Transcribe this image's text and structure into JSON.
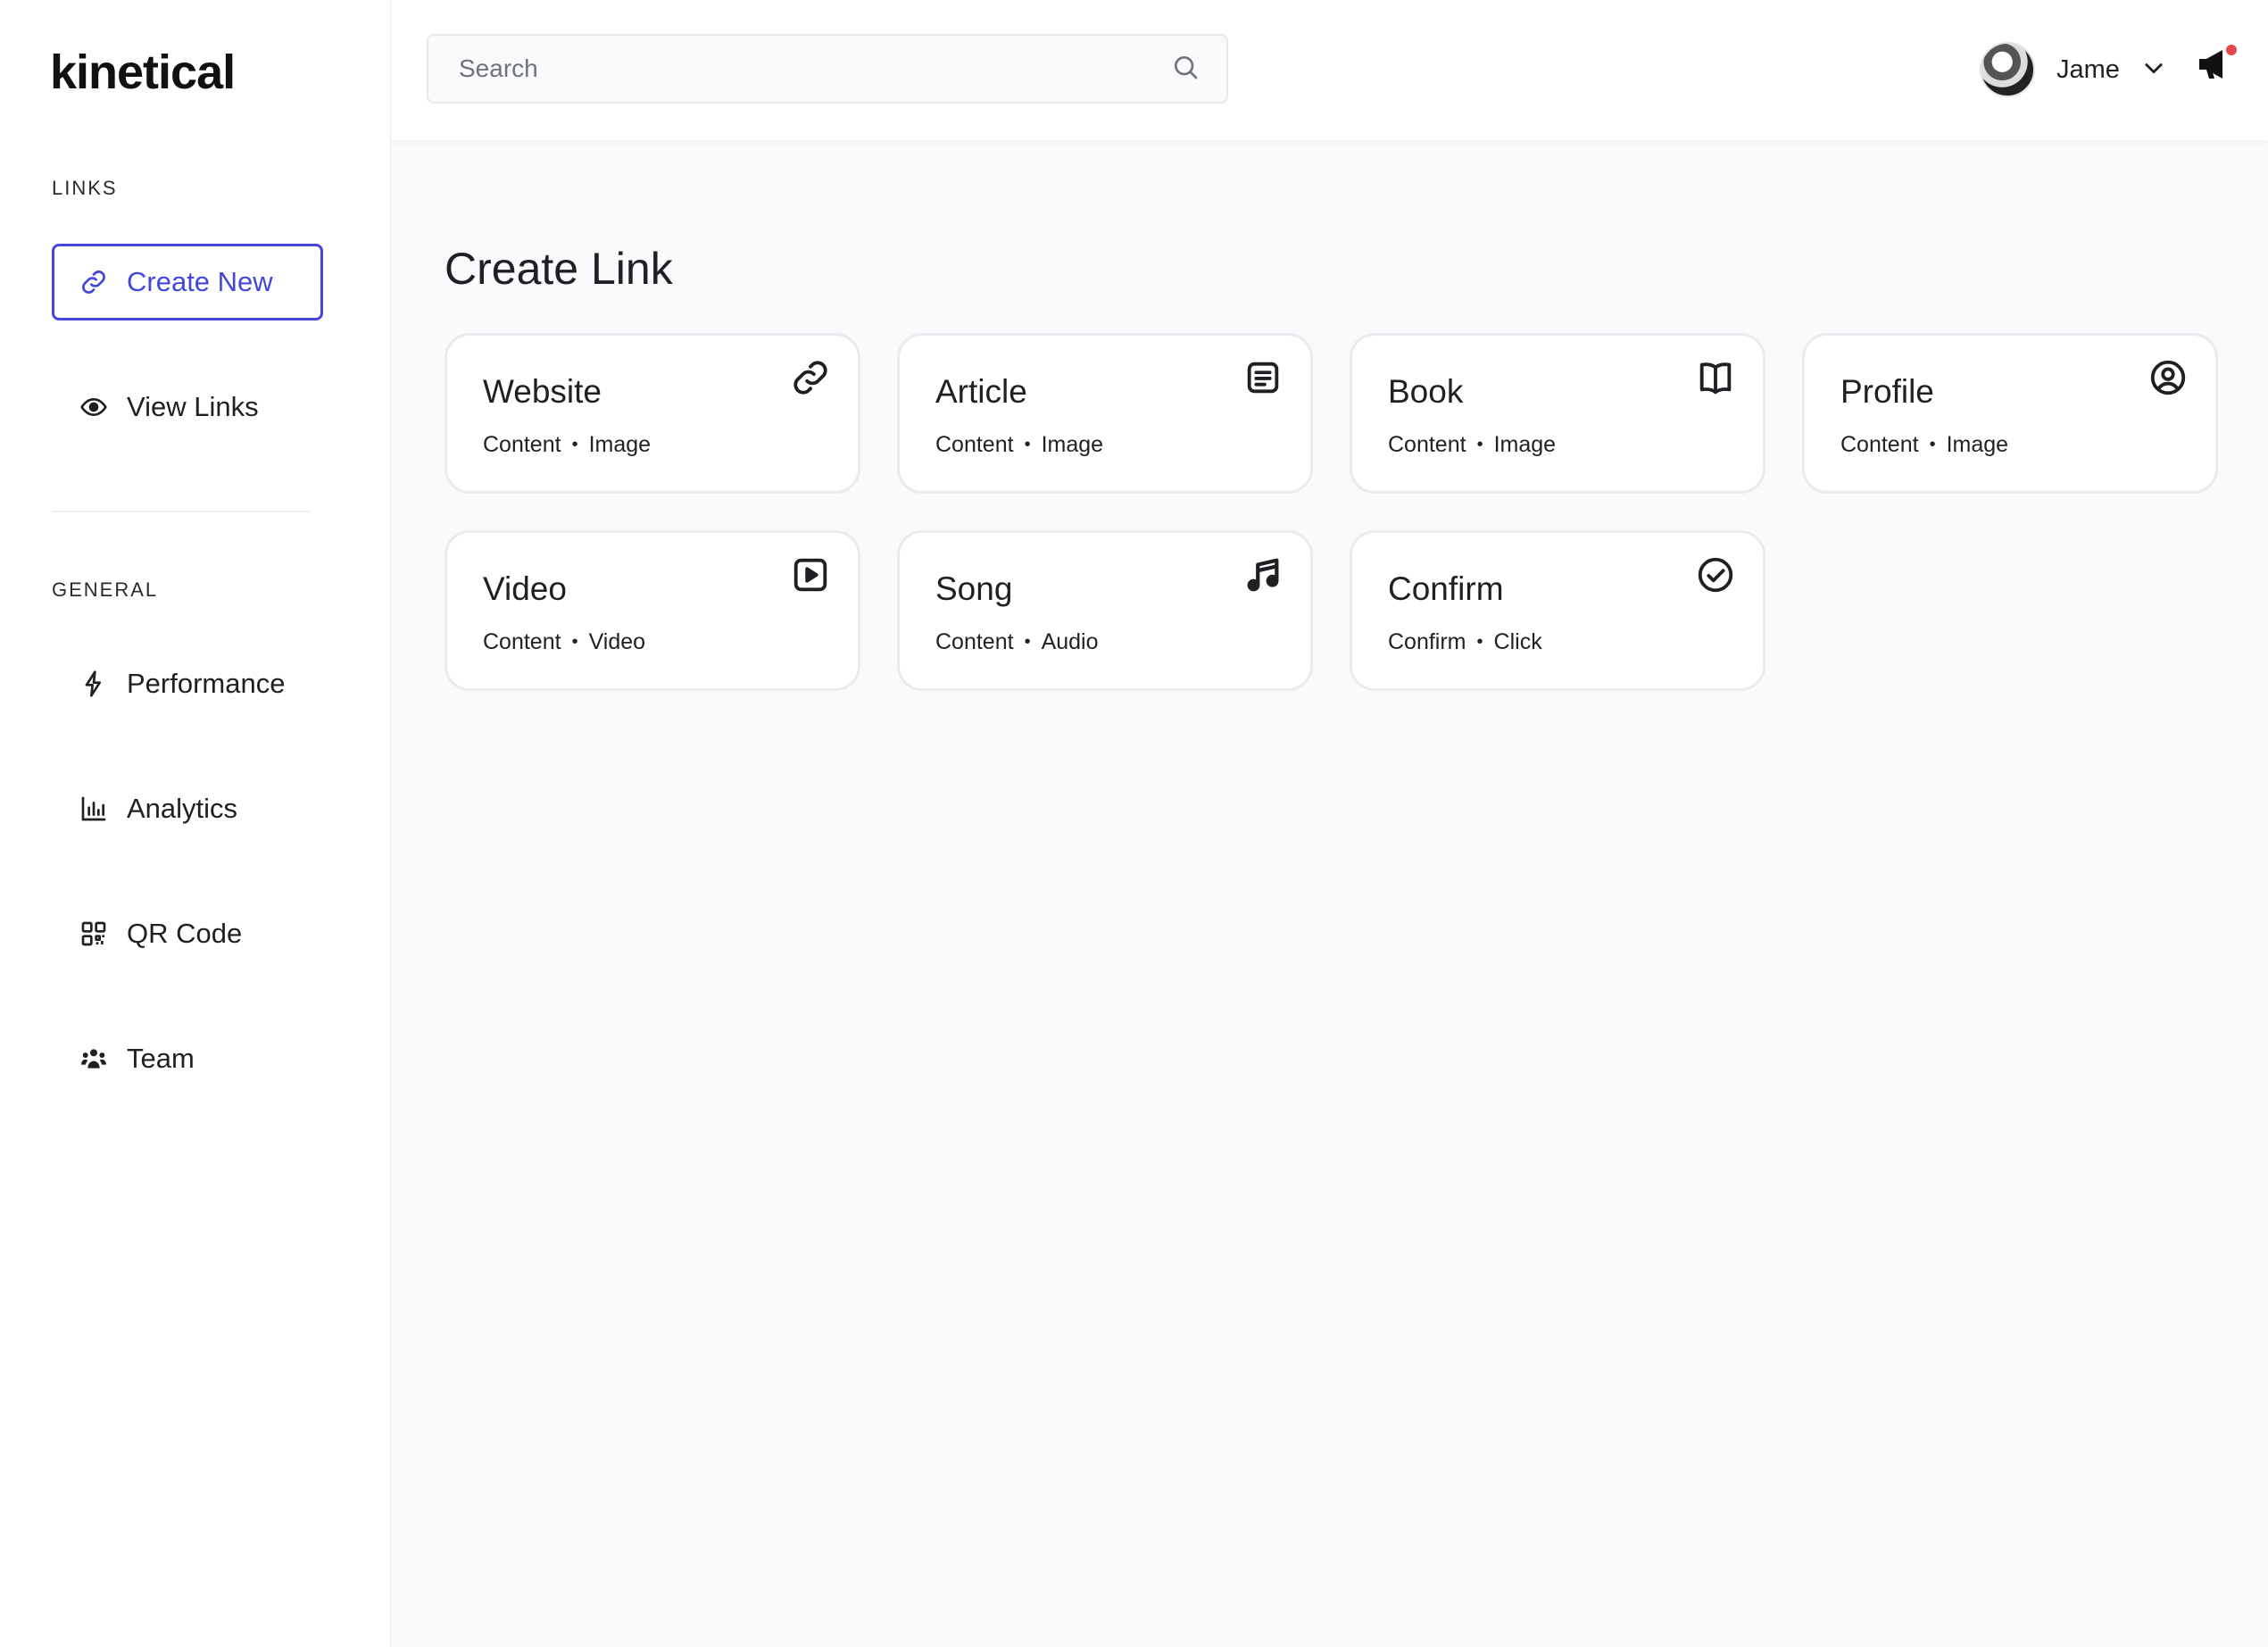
{
  "app": {
    "logo": "kinetical"
  },
  "sidebar": {
    "links_label": "LINKS",
    "general_label": "GENERAL",
    "links_items": [
      {
        "label": "Create New",
        "icon": "link-icon",
        "active": true
      },
      {
        "label": "View Links",
        "icon": "eye-icon",
        "active": false
      }
    ],
    "general_items": [
      {
        "label": "Performance",
        "icon": "bolt-icon"
      },
      {
        "label": "Analytics",
        "icon": "bar-chart-icon"
      },
      {
        "label": "QR Code",
        "icon": "qr-code-icon"
      },
      {
        "label": "Team",
        "icon": "team-icon"
      }
    ]
  },
  "header": {
    "search": {
      "placeholder": "Search",
      "value": ""
    },
    "user": {
      "name": "Jame"
    },
    "notifications": {
      "has_unread": true
    }
  },
  "main": {
    "title": "Create Link",
    "cards": [
      {
        "title": "Website",
        "meta": [
          "Content",
          "Image"
        ],
        "icon": "link-icon"
      },
      {
        "title": "Article",
        "meta": [
          "Content",
          "Image"
        ],
        "icon": "article-icon"
      },
      {
        "title": "Book",
        "meta": [
          "Content",
          "Image"
        ],
        "icon": "book-icon"
      },
      {
        "title": "Profile",
        "meta": [
          "Content",
          "Image"
        ],
        "icon": "profile-icon"
      },
      {
        "title": "Video",
        "meta": [
          "Content",
          "Video"
        ],
        "icon": "video-icon"
      },
      {
        "title": "Song",
        "meta": [
          "Content",
          "Audio"
        ],
        "icon": "music-icon"
      },
      {
        "title": "Confirm",
        "meta": [
          "Confirm",
          "Click"
        ],
        "icon": "check-circle-icon"
      }
    ]
  },
  "colors": {
    "accent": "#4347d9",
    "background": "#f9fafb",
    "notification_dot": "#e5484d"
  }
}
